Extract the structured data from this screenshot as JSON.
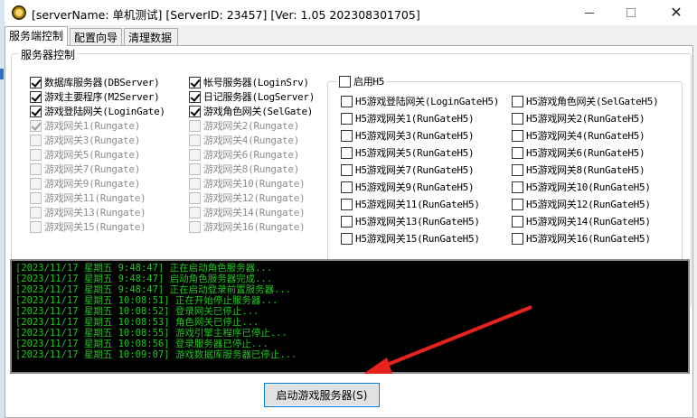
{
  "window": {
    "title": "[serverName: 单机测试] [ServerID: 23457] [Ver: 1.05 202308301705]",
    "minimize_glyph": "",
    "maximize_glyph": "",
    "close_glyph": "✕"
  },
  "tabs": [
    {
      "label": "服务端控制",
      "active": true
    },
    {
      "label": "配置向导",
      "active": false
    },
    {
      "label": "清理数据",
      "active": false
    }
  ],
  "server_group": {
    "legend": "服务器控制",
    "col1": [
      {
        "label": "数据库服务器(DBServer)",
        "checked": true,
        "enabled": true
      },
      {
        "label": "游戏主要程序(M2Server)",
        "checked": true,
        "enabled": true
      },
      {
        "label": "游戏登陆网关(LoginGate)",
        "checked": true,
        "enabled": true
      },
      {
        "label": "游戏网关1(Rungate)",
        "checked": true,
        "enabled": false
      },
      {
        "label": "游戏网关3(Rungate)",
        "checked": false,
        "enabled": false
      },
      {
        "label": "游戏网关5(Rungate)",
        "checked": false,
        "enabled": false
      },
      {
        "label": "游戏网关7(Rungate)",
        "checked": false,
        "enabled": false
      },
      {
        "label": "游戏网关9(Rungate)",
        "checked": false,
        "enabled": false
      },
      {
        "label": "游戏网关11(Rungate)",
        "checked": false,
        "enabled": false
      },
      {
        "label": "游戏网关13(Rungate)",
        "checked": false,
        "enabled": false
      },
      {
        "label": "游戏网关15(Rungate)",
        "checked": false,
        "enabled": false
      }
    ],
    "col2": [
      {
        "label": "帐号服务器(LoginSrv)",
        "checked": true,
        "enabled": true
      },
      {
        "label": "日记服务器(LogServer)",
        "checked": true,
        "enabled": true
      },
      {
        "label": "游戏角色网关(SelGate)",
        "checked": true,
        "enabled": true
      },
      {
        "label": "游戏网关2(Rungate)",
        "checked": false,
        "enabled": false
      },
      {
        "label": "游戏网关4(Rungate)",
        "checked": false,
        "enabled": false
      },
      {
        "label": "游戏网关6(Rungate)",
        "checked": false,
        "enabled": false
      },
      {
        "label": "游戏网关8(Rungate)",
        "checked": false,
        "enabled": false
      },
      {
        "label": "游戏网关10(Rungate)",
        "checked": false,
        "enabled": false
      },
      {
        "label": "游戏网关12(Rungate)",
        "checked": false,
        "enabled": false
      },
      {
        "label": "游戏网关14(Rungate)",
        "checked": false,
        "enabled": false
      },
      {
        "label": "游戏网关16(Rungate)",
        "checked": false,
        "enabled": false
      }
    ]
  },
  "h5_group": {
    "enable_label": "启用H5",
    "enable_checked": false,
    "col1": [
      "H5游戏登陆网关(LoginGateH5)",
      "H5游戏网关1(RunGateH5)",
      "H5游戏网关3(RunGateH5)",
      "H5游戏网关5(RunGateH5)",
      "H5游戏网关7(RunGateH5)",
      "H5游戏网关9(RunGateH5)",
      "H5游戏网关11(RunGateH5)",
      "H5游戏网关13(RunGateH5)",
      "H5游戏网关15(RunGateH5)"
    ],
    "col2": [
      "H5游戏角色网关(SelGateH5)",
      "H5游戏网关2(RunGateH5)",
      "H5游戏网关4(RunGateH5)",
      "H5游戏网关6(RunGateH5)",
      "H5游戏网关8(RunGateH5)",
      "H5游戏网关10(RunGateH5)",
      "H5游戏网关12(RunGateH5)",
      "H5游戏网关14(RunGateH5)",
      "H5游戏网关16(RunGateH5)"
    ]
  },
  "log": [
    "[2023/11/17 星期五 9:48:47] 正在启动角色服务器...",
    "[2023/11/17 星期五 9:48:47] 启动角色服务器完成...",
    "[2023/11/17 星期五 9:48:47] 正在启动登录前置服务器...",
    "[2023/11/17 星期五 10:08:51] 正在开始停止服务器...",
    "[2023/11/17 星期五 10:08:52] 登录网关已停止...",
    "[2023/11/17 星期五 10:08:53] 角色网关已停止...",
    "[2023/11/17 星期五 10:08:55] 游戏引擎主程序已停止...",
    "[2023/11/17 星期五 10:08:56] 登录服务器已停止...",
    "[2023/11/17 星期五 10:09:07] 游戏数据库服务器已停止..."
  ],
  "start_button": {
    "label": "启动游戏服务器(S)"
  },
  "colors": {
    "log_text": "#1ec81e",
    "arrow": "#e8231f",
    "button_border": "#0078d7"
  }
}
